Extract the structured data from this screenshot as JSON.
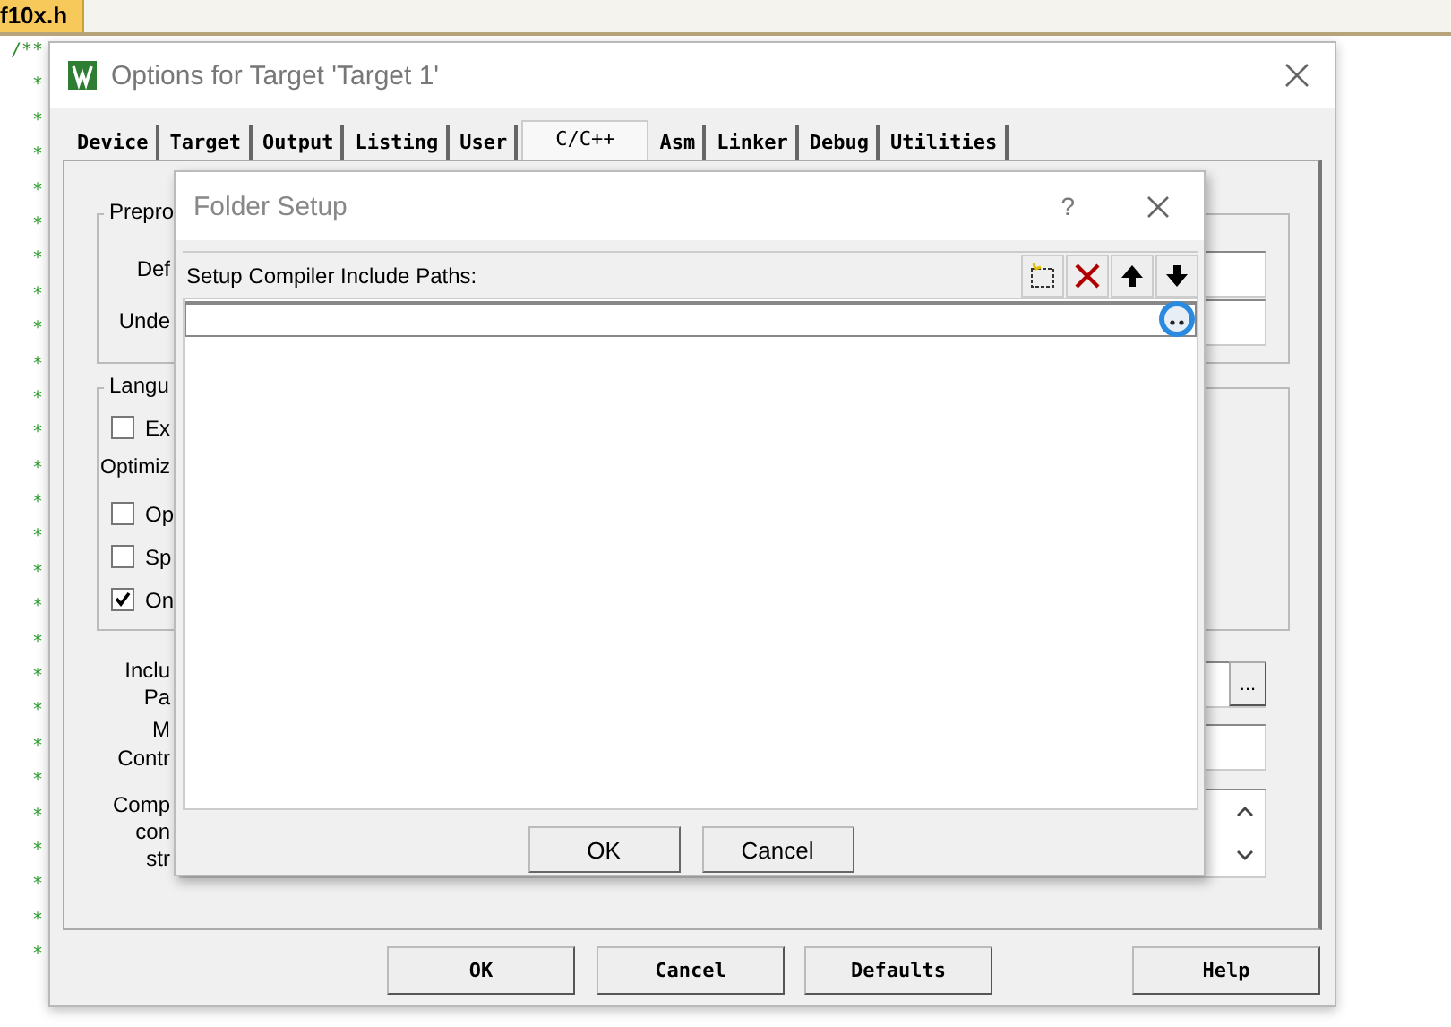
{
  "editor": {
    "tab": "f10x.h",
    "lines": [
      "/**",
      "*",
      "*",
      "*",
      "*",
      "*",
      "*",
      "*",
      "*",
      "*",
      "*",
      "*",
      "*",
      "*",
      "*",
      "*",
      "*",
      "*",
      "*",
      "*",
      "*",
      "*",
      "*",
      "*",
      "*",
      "*",
      "*"
    ]
  },
  "options_dialog": {
    "title": "Options for Target 'Target 1'",
    "tabs": [
      {
        "label": "Device",
        "selected": false
      },
      {
        "label": "Target",
        "selected": false
      },
      {
        "label": "Output",
        "selected": false
      },
      {
        "label": "Listing",
        "selected": false
      },
      {
        "label": "User",
        "selected": false
      },
      {
        "label": "C/C++",
        "selected": true
      },
      {
        "label": "Asm",
        "selected": false
      },
      {
        "label": "Linker",
        "selected": false
      },
      {
        "label": "Debug",
        "selected": false
      },
      {
        "label": "Utilities",
        "selected": false
      }
    ],
    "preprocessor_group": {
      "title": "Prepro",
      "labels": [
        "Def",
        "Unde"
      ]
    },
    "language_group": {
      "title": "Langu",
      "items": [
        {
          "kind": "checkbox",
          "label": "Ex",
          "checked": false
        },
        {
          "kind": "label",
          "label": "Optimiz"
        },
        {
          "kind": "checkbox",
          "label": "Op",
          "checked": false
        },
        {
          "kind": "checkbox",
          "label": "Sp",
          "checked": false
        },
        {
          "kind": "checkbox",
          "label": "On",
          "checked": true
        }
      ]
    },
    "include_label": [
      "Inclu",
      "Pa"
    ],
    "misc_label": [
      "M",
      "Contr"
    ],
    "compiler_label": [
      "Comp",
      "con",
      "str"
    ],
    "browse_button": "...",
    "buttons": [
      "OK",
      "Cancel",
      "Defaults",
      "Help"
    ]
  },
  "folder_dialog": {
    "title": "Folder Setup",
    "help": "?",
    "list_label": "Setup Compiler Include Paths:",
    "buttons": [
      "OK",
      "Cancel"
    ]
  }
}
